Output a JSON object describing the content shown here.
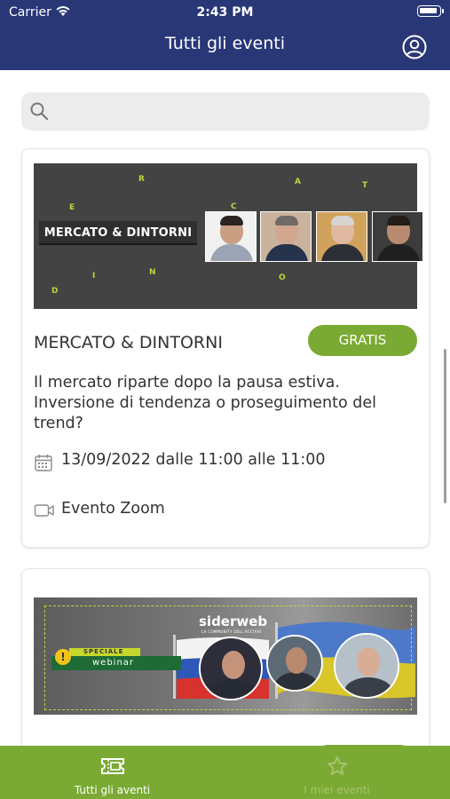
{
  "status_bar": {
    "carrier": "Carrier",
    "time": "2:43 PM"
  },
  "header": {
    "title": "Tutti gli eventi"
  },
  "search": {
    "placeholder": ""
  },
  "events": [
    {
      "banner_title": "MERCATO & DINTORNI",
      "title": "MERCATO & DINTORNI",
      "price_badge": "GRATIS",
      "description": "Il mercato riparte dopo la pausa estiva. Inversione di tendenza o proseguimento del trend?",
      "date": "13/09/2022 dalle 11:00 alle 11:00",
      "location": "Evento Zoom"
    },
    {
      "banner_logo": "siderweb",
      "banner_logo_sub": "LA COMMUNITY DELL'ACCIAIO",
      "banner_tag": "SPECIALE",
      "banner_subtitle": "webinar"
    }
  ],
  "tab_bar": {
    "items": [
      {
        "label": "Tutti gli aventi",
        "icon": "ticket-icon",
        "active": true
      },
      {
        "label": "I miei eventi",
        "icon": "star-icon",
        "active": false
      }
    ]
  },
  "colors": {
    "nav_bar": "#293777",
    "accent_green": "#7aaa33",
    "tab_inactive": "#a9c36f",
    "banner_letters": "#bcd63c"
  }
}
